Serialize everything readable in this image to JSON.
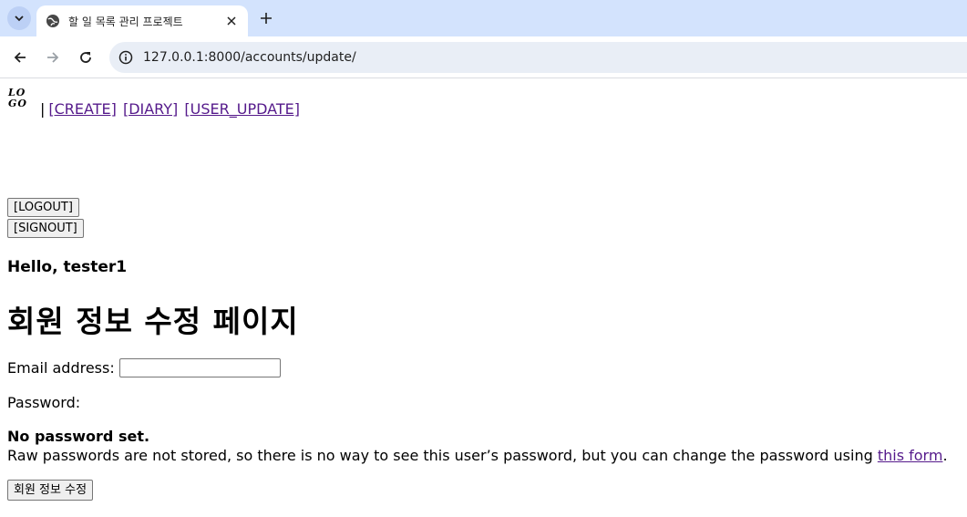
{
  "browser": {
    "tab_title": "할 일 목록 관리 프로젝트",
    "url": "127.0.0.1:8000/accounts/update/"
  },
  "header": {
    "logo_line1": "LO",
    "logo_line2": "GO",
    "separator": "|",
    "links": {
      "create": "[CREATE]",
      "diary": "[DIARY]",
      "user_update": "[USER_UPDATE]"
    },
    "logout_label": "[LOGOUT]",
    "signout_label": "[SIGNOUT]"
  },
  "main": {
    "greeting": "Hello, tester1",
    "title": "회원 정보 수정 페이지",
    "email_label": "Email address:",
    "email_value": "",
    "password_label": "Password:",
    "password_status": "No password set.",
    "password_help_prefix": "Raw passwords are not stored, so there is no way to see this user’s password, but you can change the password using ",
    "password_help_link": "this form",
    "password_help_suffix": ".",
    "submit_label": "회원 정보 수정"
  },
  "colors": {
    "tabstrip": "#d3e3fd",
    "omnibox": "#e9eef6",
    "visited_link": "#551a8b"
  }
}
